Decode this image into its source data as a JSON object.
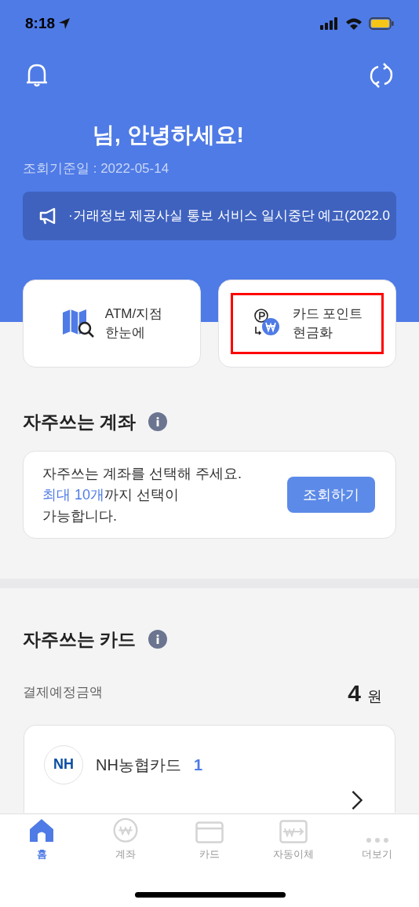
{
  "status_bar": {
    "time": "8:18"
  },
  "header": {
    "greeting": "님, 안녕하세요!",
    "date": "조회기준일 : 2022-05-14",
    "notice": "·거래정보 제공사실 통보 서비스 일시중단 예고(2022.0"
  },
  "shortcuts": [
    {
      "kind": "map",
      "lines": [
        "ATM/지점",
        "한눈에"
      ],
      "highlighted": false
    },
    {
      "kind": "points",
      "lines": [
        "카드 포인트",
        "현금화"
      ],
      "highlighted": true
    }
  ],
  "accounts": {
    "title": "자주쓰는 계좌",
    "message": "자주쓰는 계좌를 선택해 주세요.\n**최대 10개**까지 선택이\n가능합니다.",
    "button": "조회하기"
  },
  "cards": {
    "title": "자주쓰는 카드",
    "amount_label": "결제예정금액",
    "amount": "4",
    "unit": "원",
    "card": {
      "logo": "NH",
      "name": "NH농협카드",
      "count": "1"
    }
  },
  "tab_bar": [
    {
      "kind": "home",
      "label": "홈",
      "selected": true
    },
    {
      "kind": "account",
      "label": "계좌",
      "selected": false
    },
    {
      "kind": "card",
      "label": "카드",
      "selected": false
    },
    {
      "kind": "transfer",
      "label": "자동이체",
      "selected": false
    },
    {
      "kind": "more",
      "label": "더보기",
      "selected": false
    }
  ]
}
